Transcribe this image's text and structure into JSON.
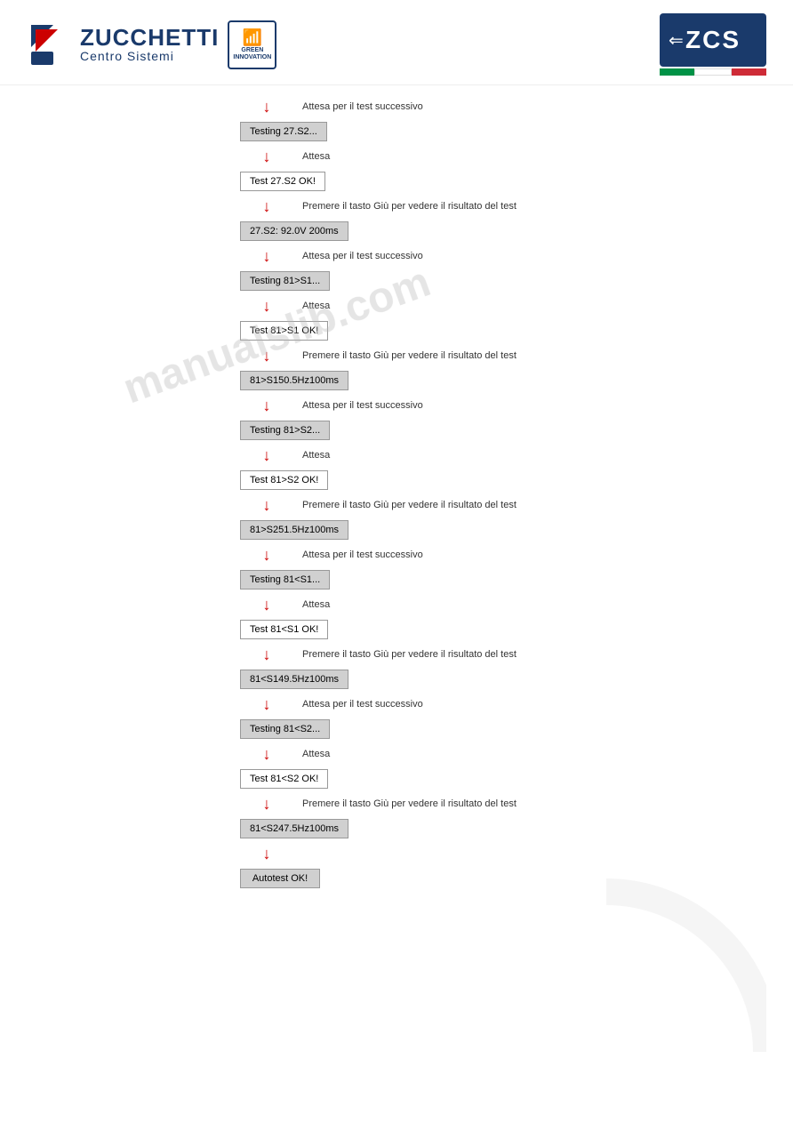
{
  "header": {
    "company_name": "ZUCCHETTI",
    "subtitle": "Centro Sistemi",
    "green_innovation": "GREEN\nINNOVATION",
    "zcs_label": "ZCS"
  },
  "flow": {
    "items": [
      {
        "type": "arrow",
        "label": "Attesa per il test successivo"
      },
      {
        "type": "box",
        "text": "Testing 27.S2...",
        "bg": "gray"
      },
      {
        "type": "arrow",
        "label": "Attesa"
      },
      {
        "type": "box",
        "text": "Test 27.S2 OK!",
        "bg": "white"
      },
      {
        "type": "arrow",
        "label": "Premere il tasto Giù per vedere il risultato del test"
      },
      {
        "type": "box",
        "text": "27.S2: 92.0V 200ms",
        "bg": "gray"
      },
      {
        "type": "arrow",
        "label": "Attesa per il test successivo"
      },
      {
        "type": "box",
        "text": "Testing 81>S1...",
        "bg": "gray"
      },
      {
        "type": "arrow",
        "label": "Attesa"
      },
      {
        "type": "box",
        "text": "Test 81>S1 OK!",
        "bg": "white"
      },
      {
        "type": "arrow",
        "label": "Premere il tasto Giù per vedere il risultato del test"
      },
      {
        "type": "box",
        "text": "81>S150.5Hz100ms",
        "bg": "gray"
      },
      {
        "type": "arrow",
        "label": "Attesa per il test successivo"
      },
      {
        "type": "box",
        "text": "Testing 81>S2...",
        "bg": "gray"
      },
      {
        "type": "arrow",
        "label": "Attesa"
      },
      {
        "type": "box",
        "text": "Test 81>S2 OK!",
        "bg": "white"
      },
      {
        "type": "arrow",
        "label": "Premere il tasto Giù per vedere il risultato del test"
      },
      {
        "type": "box",
        "text": "81>S251.5Hz100ms",
        "bg": "gray"
      },
      {
        "type": "arrow",
        "label": "Attesa per il test successivo"
      },
      {
        "type": "box",
        "text": "Testing 81<S1...",
        "bg": "gray"
      },
      {
        "type": "arrow",
        "label": "Attesa"
      },
      {
        "type": "box",
        "text": "Test 81<S1 OK!",
        "bg": "white"
      },
      {
        "type": "arrow",
        "label": "Premere il tasto Giù per vedere il risultato del test"
      },
      {
        "type": "box",
        "text": "81<S149.5Hz100ms",
        "bg": "gray"
      },
      {
        "type": "arrow",
        "label": "Attesa per il test successivo"
      },
      {
        "type": "box",
        "text": "Testing 81<S2...",
        "bg": "gray"
      },
      {
        "type": "arrow",
        "label": "Attesa"
      },
      {
        "type": "box",
        "text": "Test 81<S2 OK!",
        "bg": "white"
      },
      {
        "type": "arrow",
        "label": "Premere il tasto Giù per vedere il risultato del test"
      },
      {
        "type": "box",
        "text": "81<S247.5Hz100ms",
        "bg": "gray"
      },
      {
        "type": "arrow",
        "label": ""
      },
      {
        "type": "box",
        "text": "Autotest OK!",
        "bg": "gray"
      }
    ]
  }
}
